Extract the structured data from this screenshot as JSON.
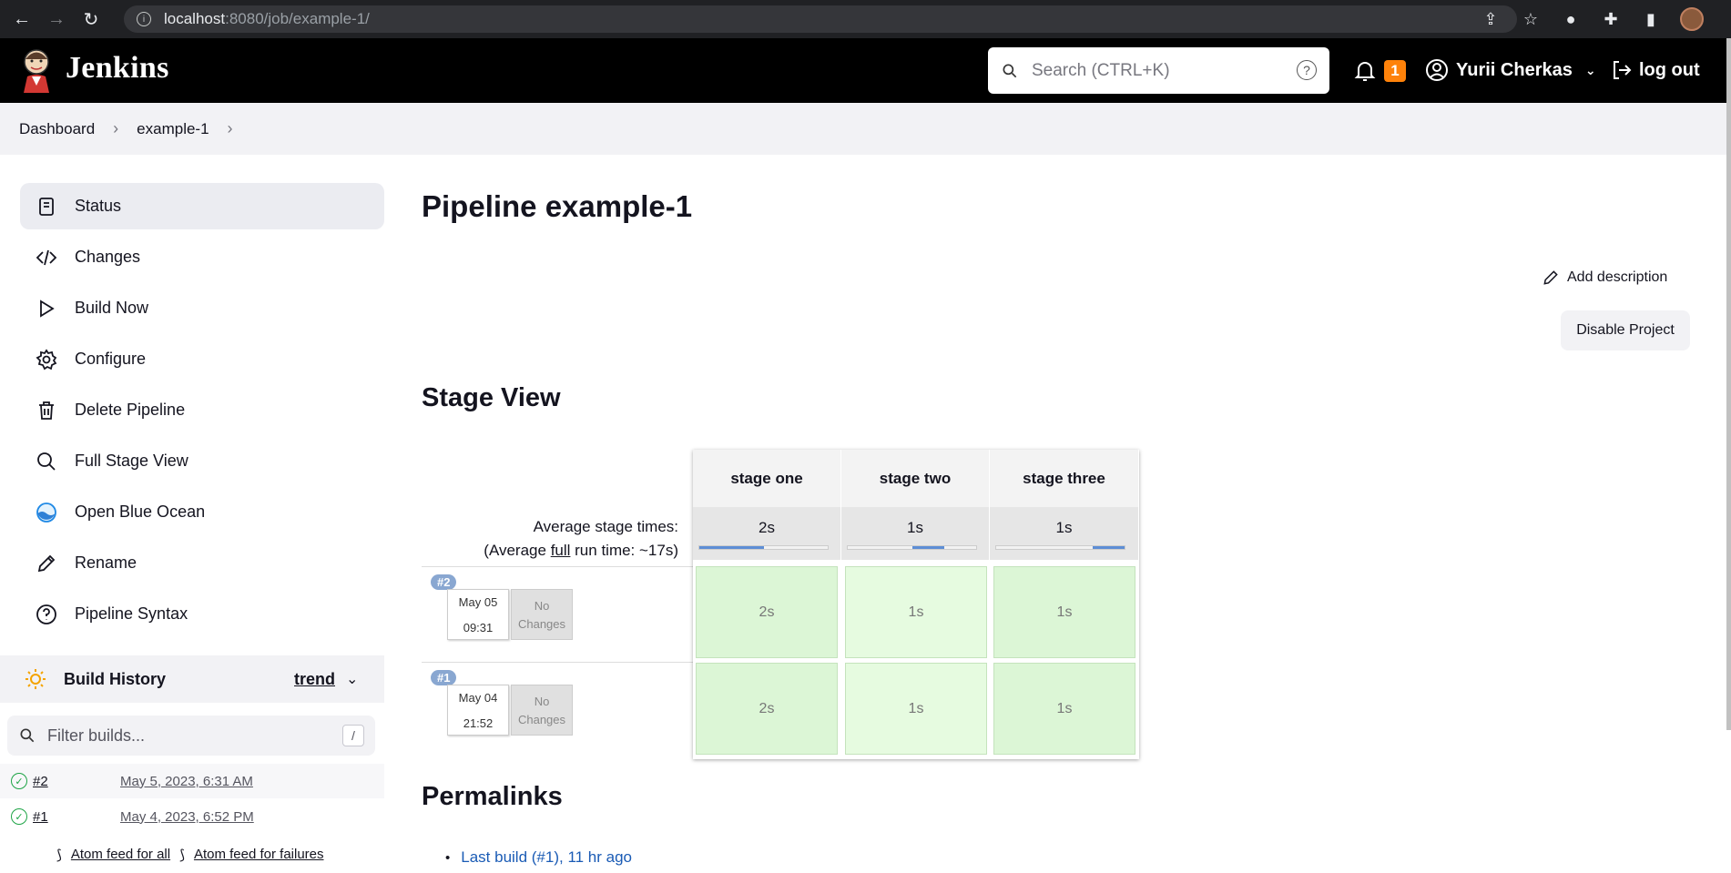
{
  "browser": {
    "url_host": "localhost",
    "url_path": ":8080/job/example-1/"
  },
  "header": {
    "app_title": "Jenkins",
    "search_placeholder": "Search (CTRL+K)",
    "notification_count": "1",
    "user_name": "Yurii Cherkas",
    "logout_label": "log out"
  },
  "breadcrumb": [
    {
      "label": "Dashboard"
    },
    {
      "label": "example-1"
    }
  ],
  "sidebar": {
    "items": [
      {
        "label": "Status",
        "icon": "document-icon"
      },
      {
        "label": "Changes",
        "icon": "code-icon"
      },
      {
        "label": "Build Now",
        "icon": "play-icon"
      },
      {
        "label": "Configure",
        "icon": "gear-icon"
      },
      {
        "label": "Delete Pipeline",
        "icon": "trash-icon"
      },
      {
        "label": "Full Stage View",
        "icon": "search-icon"
      },
      {
        "label": "Open Blue Ocean",
        "icon": "blue-ocean-icon"
      },
      {
        "label": "Rename",
        "icon": "pencil-icon"
      },
      {
        "label": "Pipeline Syntax",
        "icon": "help-icon"
      }
    ]
  },
  "build_history": {
    "title": "Build History",
    "trend_label": "trend",
    "filter_placeholder": "Filter builds...",
    "filter_shortcut": "/",
    "builds": [
      {
        "number": "#2",
        "date": "May 5, 2023, 6:31 AM"
      },
      {
        "number": "#1",
        "date": "May 4, 2023, 6:52 PM"
      }
    ],
    "feed_all": "Atom feed for all",
    "feed_failures": "Atom feed for failures"
  },
  "main": {
    "title": "Pipeline example-1",
    "add_description": "Add description",
    "disable_project": "Disable Project",
    "stage_view_title": "Stage View",
    "permalinks_title": "Permalinks",
    "permalinks": [
      {
        "label": "Last build (#1), 11 hr ago"
      }
    ]
  },
  "stage_view": {
    "stages": [
      {
        "name": "stage one",
        "avg": "2s",
        "avg_fill": [
          0.0,
          0.5
        ]
      },
      {
        "name": "stage two",
        "avg": "1s",
        "avg_fill": [
          0.5,
          0.75
        ]
      },
      {
        "name": "stage three",
        "avg": "1s",
        "avg_fill": [
          0.75,
          1.0
        ]
      }
    ],
    "avg_label_line1": "Average stage times:",
    "avg_label_prefix": "(Average ",
    "avg_label_full": "full",
    "avg_label_suffix": " run time: ~17s)",
    "runs": [
      {
        "badge": "#2",
        "date": "May 05",
        "time": "09:31",
        "changes": "No Changes",
        "durations": [
          "2s",
          "1s",
          "1s"
        ]
      },
      {
        "badge": "#1",
        "date": "May 04",
        "time": "21:52",
        "changes": "No Changes",
        "durations": [
          "2s",
          "1s",
          "1s"
        ]
      }
    ]
  }
}
